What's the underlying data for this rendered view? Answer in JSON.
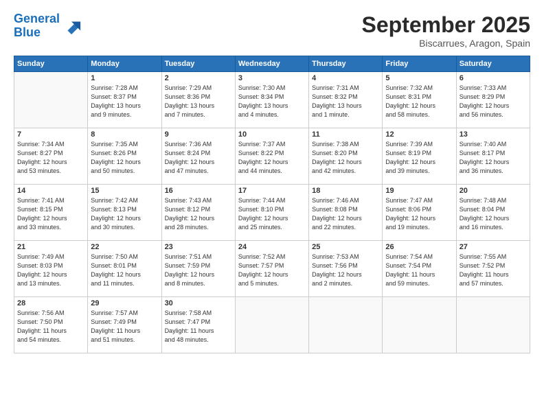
{
  "logo": {
    "line1": "General",
    "line2": "Blue"
  },
  "title": "September 2025",
  "location": "Biscarrues, Aragon, Spain",
  "days_of_week": [
    "Sunday",
    "Monday",
    "Tuesday",
    "Wednesday",
    "Thursday",
    "Friday",
    "Saturday"
  ],
  "weeks": [
    [
      {
        "day": "",
        "info": ""
      },
      {
        "day": "1",
        "info": "Sunrise: 7:28 AM\nSunset: 8:37 PM\nDaylight: 13 hours\nand 9 minutes."
      },
      {
        "day": "2",
        "info": "Sunrise: 7:29 AM\nSunset: 8:36 PM\nDaylight: 13 hours\nand 7 minutes."
      },
      {
        "day": "3",
        "info": "Sunrise: 7:30 AM\nSunset: 8:34 PM\nDaylight: 13 hours\nand 4 minutes."
      },
      {
        "day": "4",
        "info": "Sunrise: 7:31 AM\nSunset: 8:32 PM\nDaylight: 13 hours\nand 1 minute."
      },
      {
        "day": "5",
        "info": "Sunrise: 7:32 AM\nSunset: 8:31 PM\nDaylight: 12 hours\nand 58 minutes."
      },
      {
        "day": "6",
        "info": "Sunrise: 7:33 AM\nSunset: 8:29 PM\nDaylight: 12 hours\nand 56 minutes."
      }
    ],
    [
      {
        "day": "7",
        "info": "Sunrise: 7:34 AM\nSunset: 8:27 PM\nDaylight: 12 hours\nand 53 minutes."
      },
      {
        "day": "8",
        "info": "Sunrise: 7:35 AM\nSunset: 8:26 PM\nDaylight: 12 hours\nand 50 minutes."
      },
      {
        "day": "9",
        "info": "Sunrise: 7:36 AM\nSunset: 8:24 PM\nDaylight: 12 hours\nand 47 minutes."
      },
      {
        "day": "10",
        "info": "Sunrise: 7:37 AM\nSunset: 8:22 PM\nDaylight: 12 hours\nand 44 minutes."
      },
      {
        "day": "11",
        "info": "Sunrise: 7:38 AM\nSunset: 8:20 PM\nDaylight: 12 hours\nand 42 minutes."
      },
      {
        "day": "12",
        "info": "Sunrise: 7:39 AM\nSunset: 8:19 PM\nDaylight: 12 hours\nand 39 minutes."
      },
      {
        "day": "13",
        "info": "Sunrise: 7:40 AM\nSunset: 8:17 PM\nDaylight: 12 hours\nand 36 minutes."
      }
    ],
    [
      {
        "day": "14",
        "info": "Sunrise: 7:41 AM\nSunset: 8:15 PM\nDaylight: 12 hours\nand 33 minutes."
      },
      {
        "day": "15",
        "info": "Sunrise: 7:42 AM\nSunset: 8:13 PM\nDaylight: 12 hours\nand 30 minutes."
      },
      {
        "day": "16",
        "info": "Sunrise: 7:43 AM\nSunset: 8:12 PM\nDaylight: 12 hours\nand 28 minutes."
      },
      {
        "day": "17",
        "info": "Sunrise: 7:44 AM\nSunset: 8:10 PM\nDaylight: 12 hours\nand 25 minutes."
      },
      {
        "day": "18",
        "info": "Sunrise: 7:46 AM\nSunset: 8:08 PM\nDaylight: 12 hours\nand 22 minutes."
      },
      {
        "day": "19",
        "info": "Sunrise: 7:47 AM\nSunset: 8:06 PM\nDaylight: 12 hours\nand 19 minutes."
      },
      {
        "day": "20",
        "info": "Sunrise: 7:48 AM\nSunset: 8:04 PM\nDaylight: 12 hours\nand 16 minutes."
      }
    ],
    [
      {
        "day": "21",
        "info": "Sunrise: 7:49 AM\nSunset: 8:03 PM\nDaylight: 12 hours\nand 13 minutes."
      },
      {
        "day": "22",
        "info": "Sunrise: 7:50 AM\nSunset: 8:01 PM\nDaylight: 12 hours\nand 11 minutes."
      },
      {
        "day": "23",
        "info": "Sunrise: 7:51 AM\nSunset: 7:59 PM\nDaylight: 12 hours\nand 8 minutes."
      },
      {
        "day": "24",
        "info": "Sunrise: 7:52 AM\nSunset: 7:57 PM\nDaylight: 12 hours\nand 5 minutes."
      },
      {
        "day": "25",
        "info": "Sunrise: 7:53 AM\nSunset: 7:56 PM\nDaylight: 12 hours\nand 2 minutes."
      },
      {
        "day": "26",
        "info": "Sunrise: 7:54 AM\nSunset: 7:54 PM\nDaylight: 11 hours\nand 59 minutes."
      },
      {
        "day": "27",
        "info": "Sunrise: 7:55 AM\nSunset: 7:52 PM\nDaylight: 11 hours\nand 57 minutes."
      }
    ],
    [
      {
        "day": "28",
        "info": "Sunrise: 7:56 AM\nSunset: 7:50 PM\nDaylight: 11 hours\nand 54 minutes."
      },
      {
        "day": "29",
        "info": "Sunrise: 7:57 AM\nSunset: 7:49 PM\nDaylight: 11 hours\nand 51 minutes."
      },
      {
        "day": "30",
        "info": "Sunrise: 7:58 AM\nSunset: 7:47 PM\nDaylight: 11 hours\nand 48 minutes."
      },
      {
        "day": "",
        "info": ""
      },
      {
        "day": "",
        "info": ""
      },
      {
        "day": "",
        "info": ""
      },
      {
        "day": "",
        "info": ""
      }
    ]
  ]
}
